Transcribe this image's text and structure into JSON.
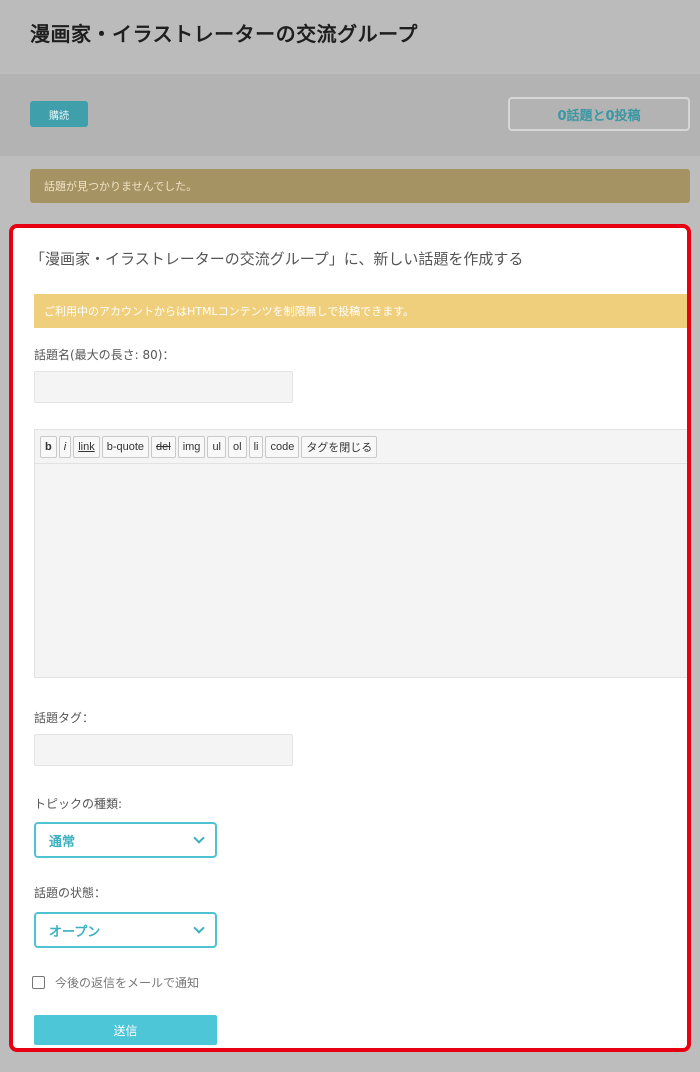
{
  "header": {
    "title": "漫画家・イラストレーターの交流グループ"
  },
  "toolbar": {
    "subscribe_label": "購読",
    "count_label": "0話題と0投稿"
  },
  "notice": {
    "empty_text": "話題が見つかりませんでした。"
  },
  "form": {
    "heading": "「漫画家・イラストレーターの交流グループ」に、新しい話題を作成する",
    "html_notice": "ご利用中のアカウントからはHTMLコンテンツを制限無しで投稿できます。",
    "title_label": "話題名(最大の長さ: 80)：",
    "title_value": "",
    "editor_buttons": [
      "b",
      "i",
      "link",
      "b-quote",
      "del",
      "img",
      "ul",
      "ol",
      "li",
      "code",
      "タグを閉じる"
    ],
    "body_value": "",
    "tags_label": "話題タグ：",
    "tags_value": "",
    "type_label": "トピックの種類:",
    "type_selected": "通常",
    "status_label": "話題の状態：",
    "status_selected": "オープン",
    "notify_label": "今後の返信をメールで通知",
    "notify_checked": false,
    "submit_label": "送信"
  },
  "colors": {
    "highlight_border": "#e60012",
    "accent": "#4dc6d8",
    "notice_yellow": "#f0cf7c"
  },
  "icons": {
    "select_arrow": "chevron-down-icon",
    "notify_box": "checkbox-icon"
  }
}
